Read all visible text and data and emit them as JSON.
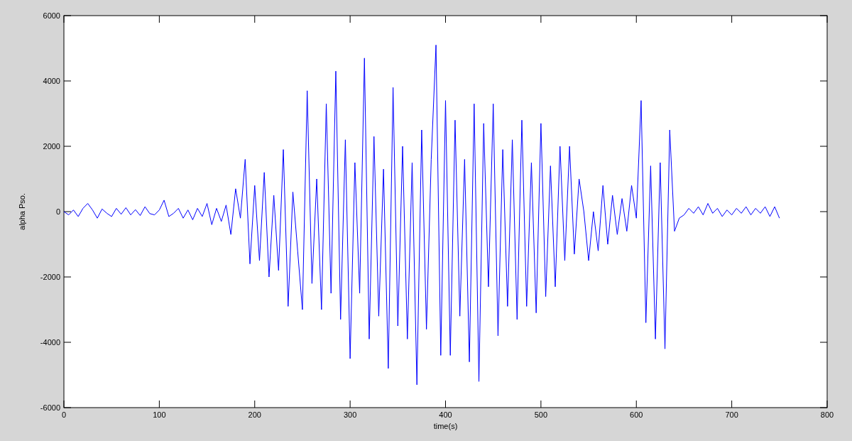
{
  "figure": {
    "chart_data": {
      "type": "line",
      "xlabel": "time(s)",
      "ylabel": "alpha Pso.",
      "x": [
        0,
        5,
        10,
        15,
        20,
        25,
        30,
        35,
        40,
        45,
        50,
        55,
        60,
        65,
        70,
        75,
        80,
        85,
        90,
        95,
        100,
        105,
        110,
        115,
        120,
        125,
        130,
        135,
        140,
        145,
        150,
        155,
        160,
        165,
        170,
        175,
        180,
        185,
        190,
        195,
        200,
        205,
        210,
        215,
        220,
        225,
        230,
        235,
        240,
        245,
        250,
        255,
        260,
        265,
        270,
        275,
        280,
        285,
        290,
        295,
        300,
        305,
        310,
        315,
        320,
        325,
        330,
        335,
        340,
        345,
        350,
        355,
        360,
        365,
        370,
        375,
        380,
        385,
        390,
        395,
        400,
        405,
        410,
        415,
        420,
        425,
        430,
        435,
        440,
        445,
        450,
        455,
        460,
        465,
        470,
        475,
        480,
        485,
        490,
        495,
        500,
        505,
        510,
        515,
        520,
        525,
        530,
        535,
        540,
        545,
        550,
        555,
        560,
        565,
        570,
        575,
        580,
        585,
        590,
        595,
        600,
        605,
        610,
        615,
        620,
        625,
        630,
        635,
        640,
        645,
        650,
        655,
        660,
        665,
        670,
        675,
        680,
        685,
        690,
        695,
        700,
        705,
        710,
        715,
        720,
        725,
        730,
        735,
        740,
        745,
        750
      ],
      "series": [
        {
          "color": "#0000ff",
          "values": [
            0,
            -100,
            50,
            -150,
            100,
            250,
            50,
            -200,
            80,
            -50,
            -150,
            100,
            -80,
            120,
            -100,
            60,
            -120,
            150,
            -60,
            -100,
            50,
            350,
            -150,
            -50,
            100,
            -200,
            50,
            -250,
            100,
            -150,
            250,
            -400,
            100,
            -300,
            200,
            -700,
            700,
            -200,
            1600,
            -1600,
            800,
            -1500,
            1200,
            -2000,
            500,
            -1800,
            1900,
            -2900,
            600,
            -1200,
            -3000,
            3700,
            -2200,
            1000,
            -3000,
            3300,
            -2500,
            4300,
            -3300,
            2200,
            -4500,
            1500,
            -2500,
            4700,
            -3900,
            2300,
            -3200,
            1300,
            -4800,
            3800,
            -3500,
            2000,
            -3900,
            1500,
            -5300,
            2500,
            -3600,
            1600,
            5100,
            -4400,
            3400,
            -4400,
            2800,
            -3200,
            1600,
            -4600,
            3300,
            -5200,
            2700,
            -2300,
            3300,
            -3800,
            1900,
            -2900,
            2200,
            -3300,
            2800,
            -2900,
            1500,
            -3100,
            2700,
            -2600,
            1400,
            -2300,
            2000,
            -1500,
            2000,
            -1300,
            1000,
            0,
            -1500,
            0,
            -1200,
            800,
            -1000,
            500,
            -700,
            400,
            -600,
            800,
            -200,
            3400,
            -3400,
            1400,
            -3900,
            1500,
            -4200,
            2500,
            -600,
            -200,
            -100,
            100,
            -50,
            150,
            -100,
            250,
            -50,
            100,
            -150,
            50,
            -100,
            100,
            -50,
            150,
            -100,
            100,
            -50,
            150,
            -150,
            150,
            -200
          ]
        }
      ],
      "xlim": [
        0,
        800
      ],
      "ylim": [
        -6000,
        6000
      ],
      "xticks": [
        0,
        100,
        200,
        300,
        400,
        500,
        600,
        700,
        800
      ],
      "yticks": [
        -6000,
        -4000,
        -2000,
        0,
        2000,
        4000,
        6000
      ]
    }
  }
}
